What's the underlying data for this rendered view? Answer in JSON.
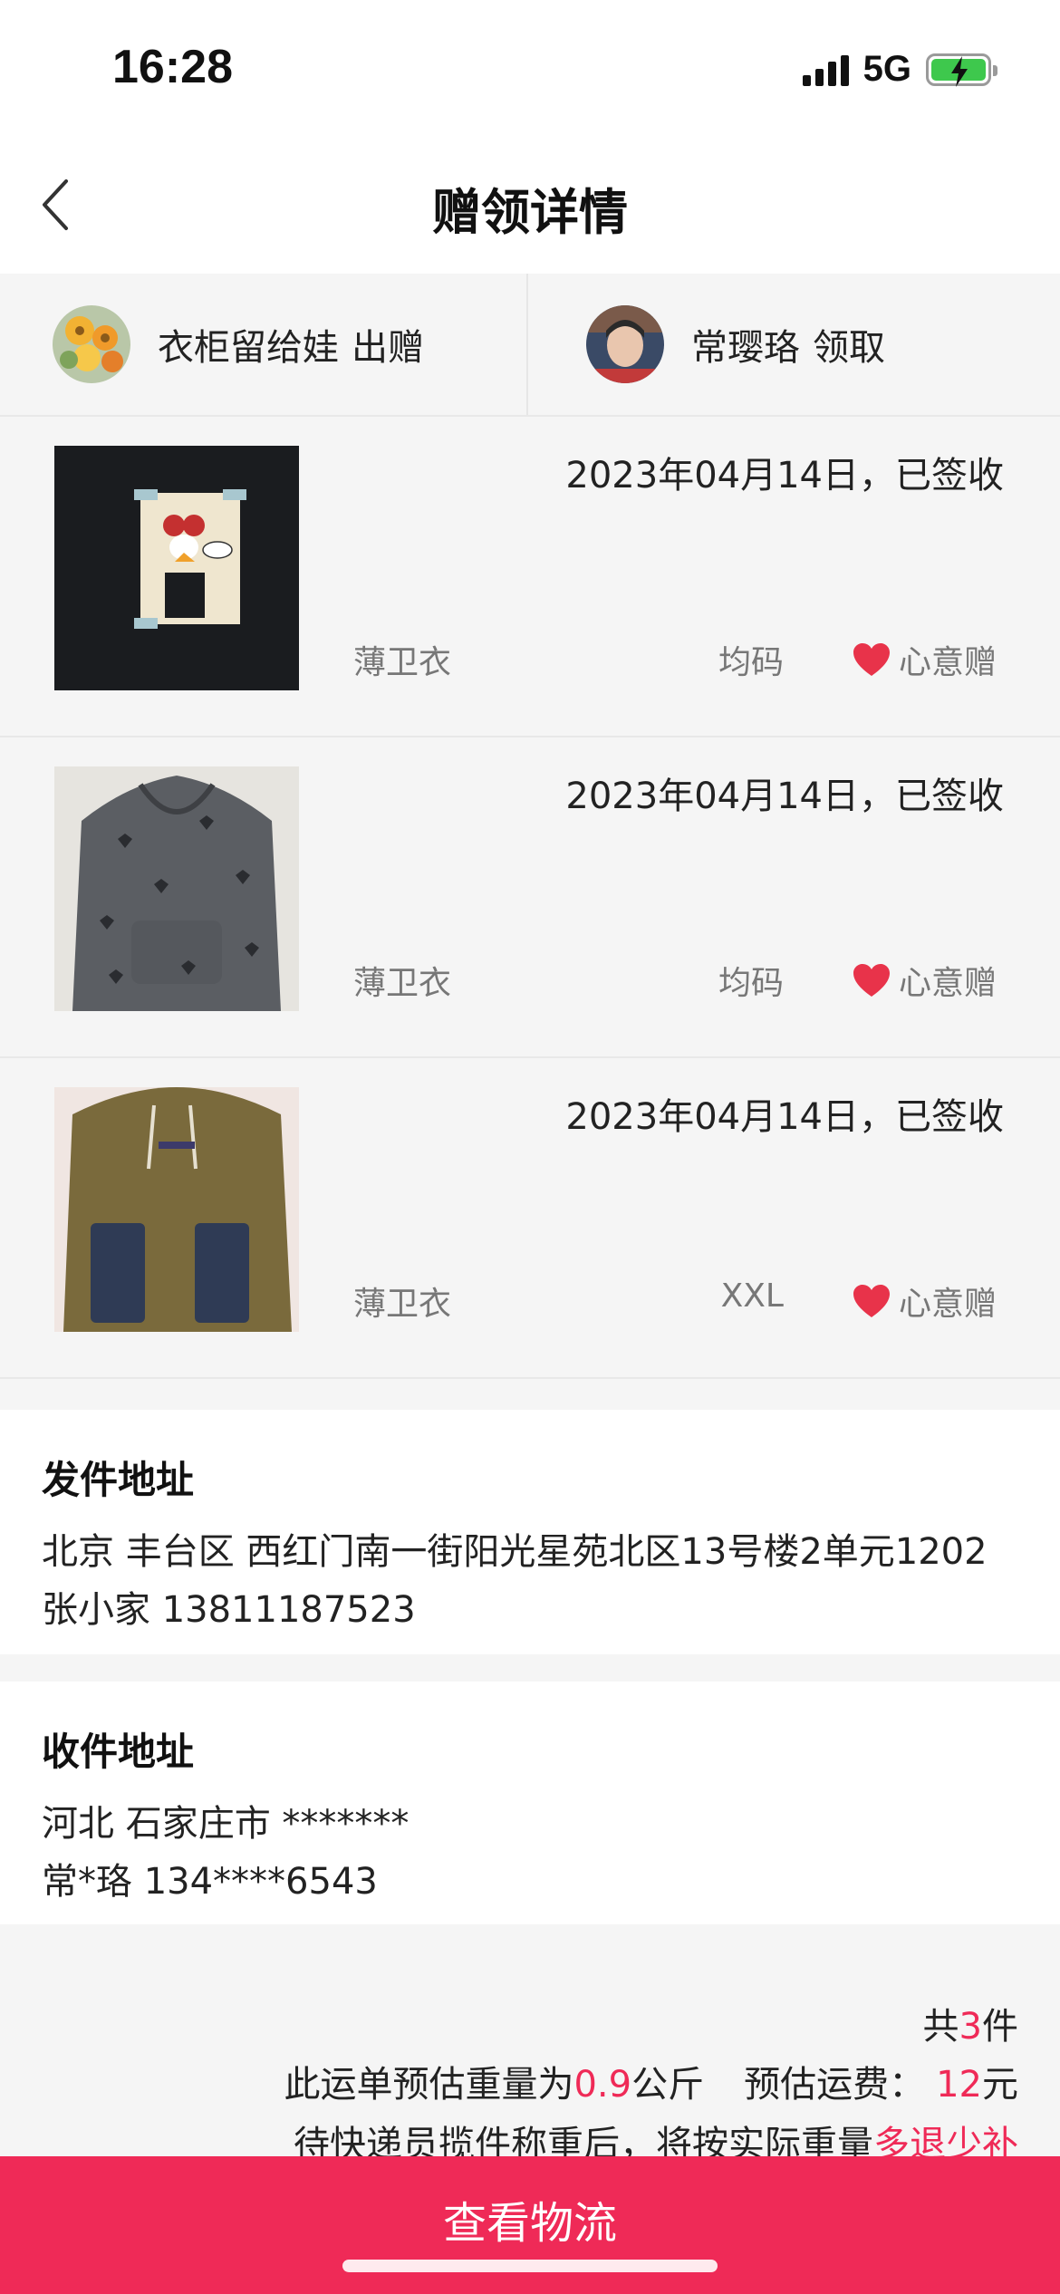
{
  "status_bar": {
    "time": "16:28",
    "network": "5G"
  },
  "nav": {
    "title": "赠领详情"
  },
  "parties": {
    "giver": {
      "name": "衣柜留给娃",
      "verb": "出赠"
    },
    "receiver": {
      "name": "常璎珞",
      "verb": "领取"
    }
  },
  "items": [
    {
      "date_status": "2023年04月14日，已签收",
      "name": "薄卫衣",
      "size": "均码",
      "tag": "心意赠"
    },
    {
      "date_status": "2023年04月14日，已签收",
      "name": "薄卫衣",
      "size": "均码",
      "tag": "心意赠"
    },
    {
      "date_status": "2023年04月14日，已签收",
      "name": "薄卫衣",
      "size": "XXL",
      "tag": "心意赠"
    }
  ],
  "sender_address": {
    "title": "发件地址",
    "line1": "北京 丰台区 西红门南一街阳光星苑北区13号楼2单元1202",
    "line2": "张小家 13811187523"
  },
  "receiver_address": {
    "title": "收件地址",
    "line1": "河北 石家庄市 *******",
    "line2": "常*珞 134****6543"
  },
  "summary": {
    "count_prefix": "共",
    "count": "3",
    "count_suffix": "件",
    "weight_prefix": "此运单预估重量为",
    "weight": "0.9",
    "weight_unit": "公斤",
    "fee_label": "预估运费：",
    "fee": "12",
    "fee_unit": "元",
    "note_prefix": "待快递员揽件称重后，将按实际重量",
    "note_highlight": "多退少补"
  },
  "bottom_button": {
    "label": "查看物流"
  },
  "colors": {
    "accent": "#ef2a57",
    "heart": "#e8334a",
    "background": "#f5f5f5"
  }
}
